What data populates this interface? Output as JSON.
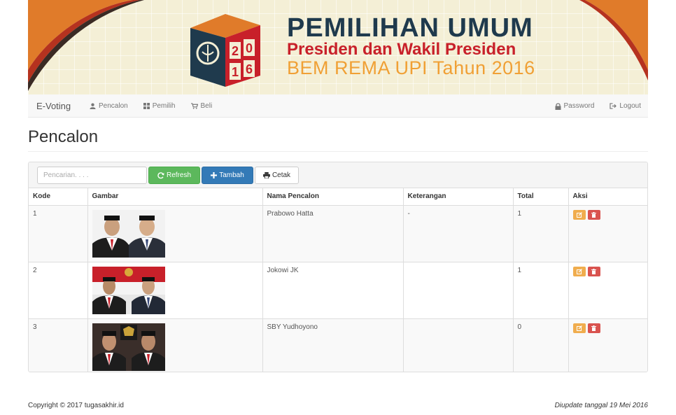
{
  "banner": {
    "year_top": "20",
    "year_bottom": "16",
    "title": "PEMILIHAN UMUM",
    "subtitle": "Presiden dan Wakil Presiden",
    "subtitle2": "BEM REMA UPI Tahun 2016"
  },
  "navbar": {
    "brand": "E-Voting",
    "left_items": [
      {
        "label": "Pencalon",
        "icon": "user-icon"
      },
      {
        "label": "Pemilih",
        "icon": "grid-icon"
      },
      {
        "label": "Beli",
        "icon": "cart-icon"
      }
    ],
    "right_items": [
      {
        "label": "Password",
        "icon": "lock-icon"
      },
      {
        "label": "Logout",
        "icon": "logout-icon"
      }
    ]
  },
  "page": {
    "title": "Pencalon"
  },
  "toolbar": {
    "search_placeholder": "Pencarian. . . .",
    "refresh_label": "Refresh",
    "add_label": "Tambah",
    "print_label": "Cetak"
  },
  "table": {
    "headers": [
      "Kode",
      "Gambar",
      "Nama Pencalon",
      "Keterangan",
      "Total",
      "Aksi"
    ],
    "rows": [
      {
        "kode": "1",
        "nama": "Prabowo Hatta",
        "keterangan": "-",
        "total": "1"
      },
      {
        "kode": "2",
        "nama": "Jokowi JK",
        "keterangan": "",
        "total": "1"
      },
      {
        "kode": "3",
        "nama": "SBY Yudhoyono",
        "keterangan": "",
        "total": "0"
      }
    ]
  },
  "footer": {
    "copyright": "Copyright © 2017 tugasakhir.id",
    "updated": "Diupdate tanggal 19 Mei 2016"
  },
  "colors": {
    "banner_orange": "#e07b2a",
    "banner_navy": "#1f3a4d",
    "banner_red": "#c8202a",
    "refresh_green": "#5cb85c",
    "add_blue": "#337ab7",
    "edit_orange": "#f0ad4e",
    "delete_red": "#d9534f"
  }
}
